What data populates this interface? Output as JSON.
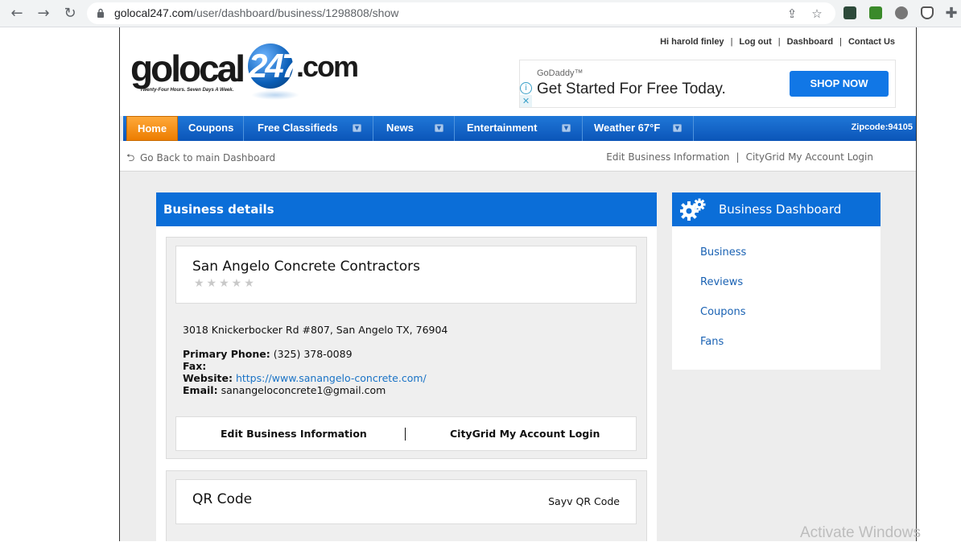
{
  "browser": {
    "url_host": "golocal247.com",
    "url_path": "/user/dashboard/business/1298808/show"
  },
  "header": {
    "logo_go": "golocal",
    "logo_num": "247",
    "logo_com": ".com",
    "tagline": "Twenty-Four Hours. Seven Days A Week.",
    "greeting": "Hi harold finley",
    "links": [
      "Log out",
      "Dashboard",
      "Contact Us"
    ],
    "ad": {
      "brand": "GoDaddy™",
      "headline": "Get Started For Free Today.",
      "cta": "SHOP NOW"
    }
  },
  "nav": {
    "items": [
      "Home",
      "Coupons",
      "Free Classifieds",
      "News",
      "Entertainment",
      "Weather 67°F"
    ],
    "zipcode": "Zipcode:94105"
  },
  "subbar": {
    "back": "Go Back to main Dashboard",
    "edit": "Edit Business Information",
    "citygrid": "CityGrid My Account Login"
  },
  "business": {
    "panel_title": "Business details",
    "name": "San Angelo Concrete Contractors",
    "rating": 0,
    "address": "3018 Knickerbocker Rd #807, San Angelo TX, 76904",
    "phone_label": "Primary Phone:",
    "phone": "(325) 378-0089",
    "fax_label": "Fax:",
    "website_label": "Website:",
    "website": "https://www.sanangelo-concrete.com/",
    "email_label": "Email:",
    "email": "sanangeloconcrete1@gmail.com",
    "action_edit": "Edit Business Information",
    "action_citygrid": "CityGrid My Account Login"
  },
  "qr": {
    "title": "QR Code",
    "save": "Sayv QR Code"
  },
  "dashboard": {
    "title": "Business Dashboard",
    "links": [
      "Business",
      "Reviews",
      "Coupons",
      "Fans"
    ]
  },
  "watermark": "Activate Windows",
  "colors": {
    "nav_blue": "#0b6ed8",
    "home_orange": "#f08a12",
    "link_blue": "#1a62b3"
  }
}
